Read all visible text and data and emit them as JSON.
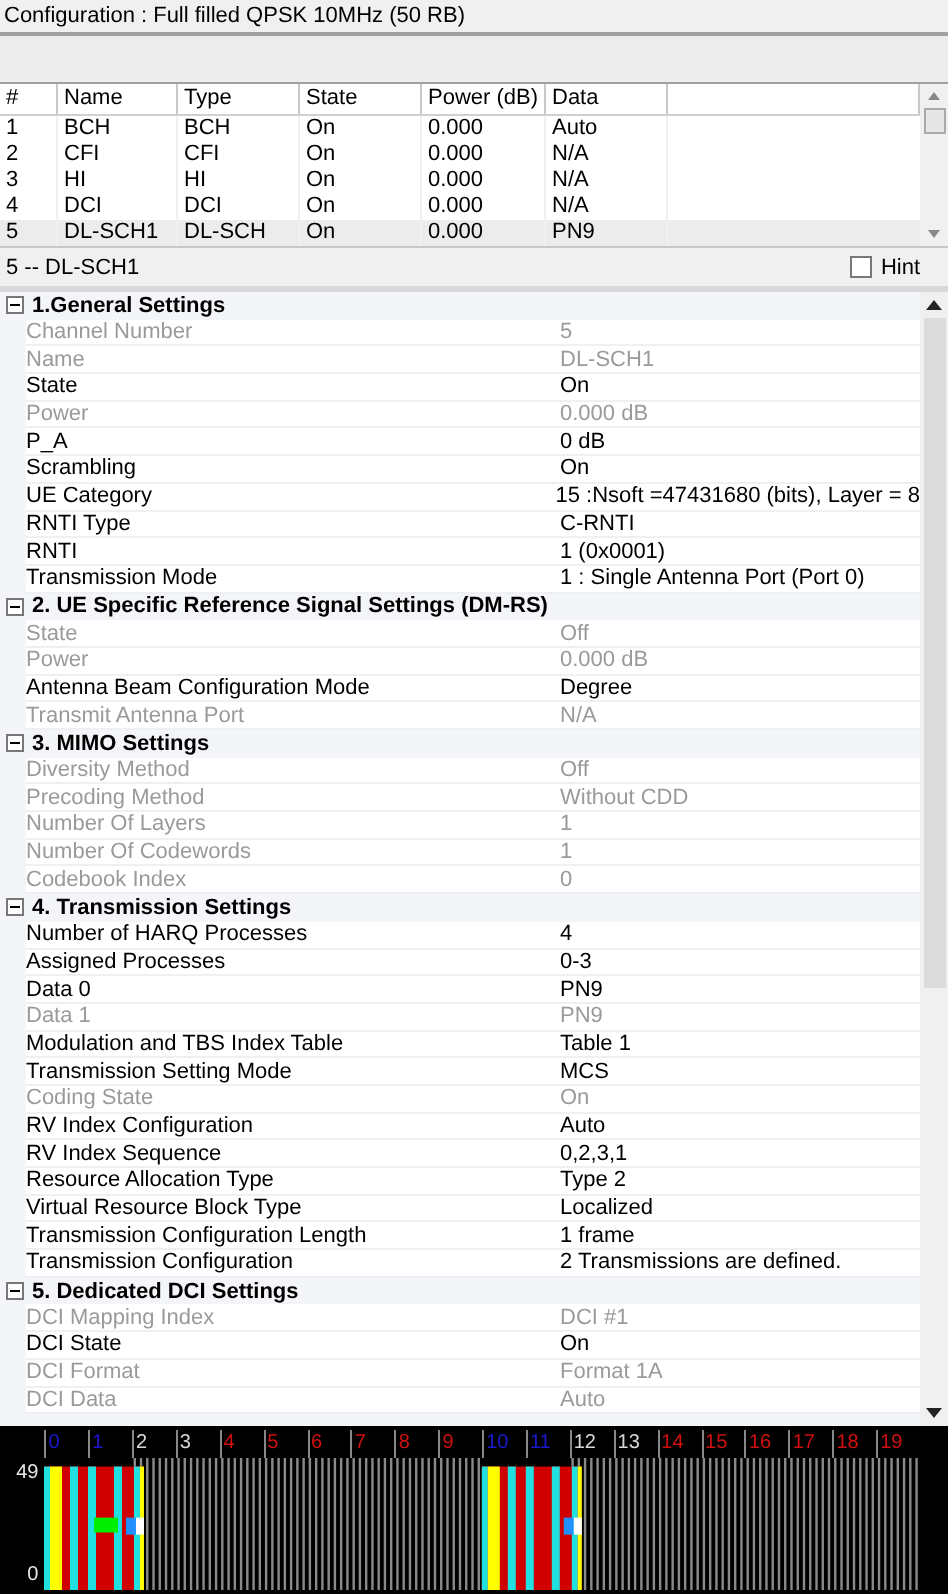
{
  "title": "Configuration : Full filled QPSK 10MHz (50 RB)",
  "table": {
    "columns": [
      "#",
      "Name",
      "Type",
      "State",
      "Power (dB)",
      "Data"
    ],
    "rows": [
      {
        "cells": [
          "1",
          "BCH",
          "BCH",
          "On",
          "0.000",
          "Auto"
        ],
        "selected": false
      },
      {
        "cells": [
          "2",
          "CFI",
          "CFI",
          "On",
          "0.000",
          "N/A"
        ],
        "selected": false
      },
      {
        "cells": [
          "3",
          "HI",
          "HI",
          "On",
          "0.000",
          "N/A"
        ],
        "selected": false
      },
      {
        "cells": [
          "4",
          "DCI",
          "DCI",
          "On",
          "0.000",
          "N/A"
        ],
        "selected": false
      },
      {
        "cells": [
          "5",
          "DL-SCH1",
          "DL-SCH",
          "On",
          "0.000",
          "PN9"
        ],
        "selected": true
      }
    ]
  },
  "selection_label": "5 -- DL-SCH1",
  "hint": {
    "label": "Hint",
    "checked": false
  },
  "sections": [
    {
      "title": "1.General Settings",
      "expanded": true,
      "rows": [
        {
          "label": "Channel Number",
          "value": "5",
          "disabled": true
        },
        {
          "label": "Name",
          "value": "DL-SCH1",
          "disabled": true
        },
        {
          "label": "State",
          "value": "On",
          "disabled": false
        },
        {
          "label": "Power",
          "value": "0.000 dB",
          "disabled": true
        },
        {
          "label": "P_A",
          "value": "0 dB",
          "disabled": false
        },
        {
          "label": "Scrambling",
          "value": "On",
          "disabled": false
        },
        {
          "label": "UE Category",
          "value": "15 :Nsoft =47431680 (bits), Layer = 8",
          "disabled": false
        },
        {
          "label": "RNTI Type",
          "value": "C-RNTI",
          "disabled": false
        },
        {
          "label": "RNTI",
          "value": "1 (0x0001)",
          "disabled": false
        },
        {
          "label": "Transmission Mode",
          "value": "1 : Single Antenna Port (Port 0)",
          "disabled": false
        }
      ]
    },
    {
      "title": "2. UE Specific Reference Signal Settings (DM-RS)",
      "expanded": true,
      "rows": [
        {
          "label": "State",
          "value": "Off",
          "disabled": true
        },
        {
          "label": "Power",
          "value": "0.000 dB",
          "disabled": true
        },
        {
          "label": "Antenna Beam Configuration Mode",
          "value": "Degree",
          "disabled": false
        },
        {
          "label": "Transmit Antenna Port",
          "value": "N/A",
          "disabled": true
        }
      ]
    },
    {
      "title": "3. MIMO Settings",
      "expanded": true,
      "rows": [
        {
          "label": "Diversity Method",
          "value": "Off",
          "disabled": true
        },
        {
          "label": "Precoding Method",
          "value": "Without CDD",
          "disabled": true
        },
        {
          "label": "Number Of Layers",
          "value": "1",
          "disabled": true
        },
        {
          "label": "Number Of Codewords",
          "value": "1",
          "disabled": true
        },
        {
          "label": "Codebook Index",
          "value": "0",
          "disabled": true
        }
      ]
    },
    {
      "title": "4. Transmission Settings",
      "expanded": true,
      "rows": [
        {
          "label": "Number of HARQ Processes",
          "value": "4",
          "disabled": false
        },
        {
          "label": "Assigned Processes",
          "value": "0-3",
          "disabled": false
        },
        {
          "label": "Data 0",
          "value": "PN9",
          "disabled": false
        },
        {
          "label": "Data 1",
          "value": "PN9",
          "disabled": true
        },
        {
          "label": "Modulation and TBS Index Table",
          "value": "Table 1",
          "disabled": false
        },
        {
          "label": "Transmission Setting Mode",
          "value": "MCS",
          "disabled": false
        },
        {
          "label": "Coding State",
          "value": "On",
          "disabled": true
        },
        {
          "label": "RV Index Configuration",
          "value": "Auto",
          "disabled": false
        },
        {
          "label": "RV Index Sequence",
          "value": "0,2,3,1",
          "disabled": false
        },
        {
          "label": "Resource Allocation Type",
          "value": "Type 2",
          "disabled": false
        },
        {
          "label": "Virtual Resource Block Type",
          "value": "Localized",
          "disabled": false
        },
        {
          "label": "Transmission Configuration Length",
          "value": "1 frame",
          "disabled": false
        },
        {
          "label": "Transmission Configuration",
          "value": "2 Transmissions are defined.",
          "disabled": false
        }
      ]
    },
    {
      "title": "5. Dedicated DCI Settings",
      "expanded": true,
      "rows": [
        {
          "label": "DCI Mapping Index",
          "value": "DCI #1",
          "disabled": true
        },
        {
          "label": "DCI State",
          "value": "On",
          "disabled": false
        },
        {
          "label": "DCI Format",
          "value": "Format 1A",
          "disabled": true
        },
        {
          "label": "DCI Data",
          "value": "Auto",
          "disabled": true
        }
      ]
    }
  ],
  "resource_grid": {
    "y_labels": [
      "49",
      "0"
    ],
    "slots": [
      {
        "label": "0",
        "color": "#1a1ad0"
      },
      {
        "label": "1",
        "color": "#1a1ad0"
      },
      {
        "label": "2",
        "color": "#d8d8d8"
      },
      {
        "label": "3",
        "color": "#d8d8d8"
      },
      {
        "label": "4",
        "color": "#d01010"
      },
      {
        "label": "5",
        "color": "#d01010"
      },
      {
        "label": "6",
        "color": "#d01010"
      },
      {
        "label": "7",
        "color": "#d01010"
      },
      {
        "label": "8",
        "color": "#d01010"
      },
      {
        "label": "9",
        "color": "#d01010"
      },
      {
        "label": "10",
        "color": "#1a1ad0"
      },
      {
        "label": "11",
        "color": "#1a1ad0"
      },
      {
        "label": "12",
        "color": "#d8d8d8"
      },
      {
        "label": "13",
        "color": "#d8d8d8"
      },
      {
        "label": "14",
        "color": "#d01010"
      },
      {
        "label": "15",
        "color": "#d01010"
      },
      {
        "label": "16",
        "color": "#d01010"
      },
      {
        "label": "17",
        "color": "#d01010"
      },
      {
        "label": "18",
        "color": "#d01010"
      },
      {
        "label": "19",
        "color": "#d01010"
      }
    ]
  }
}
